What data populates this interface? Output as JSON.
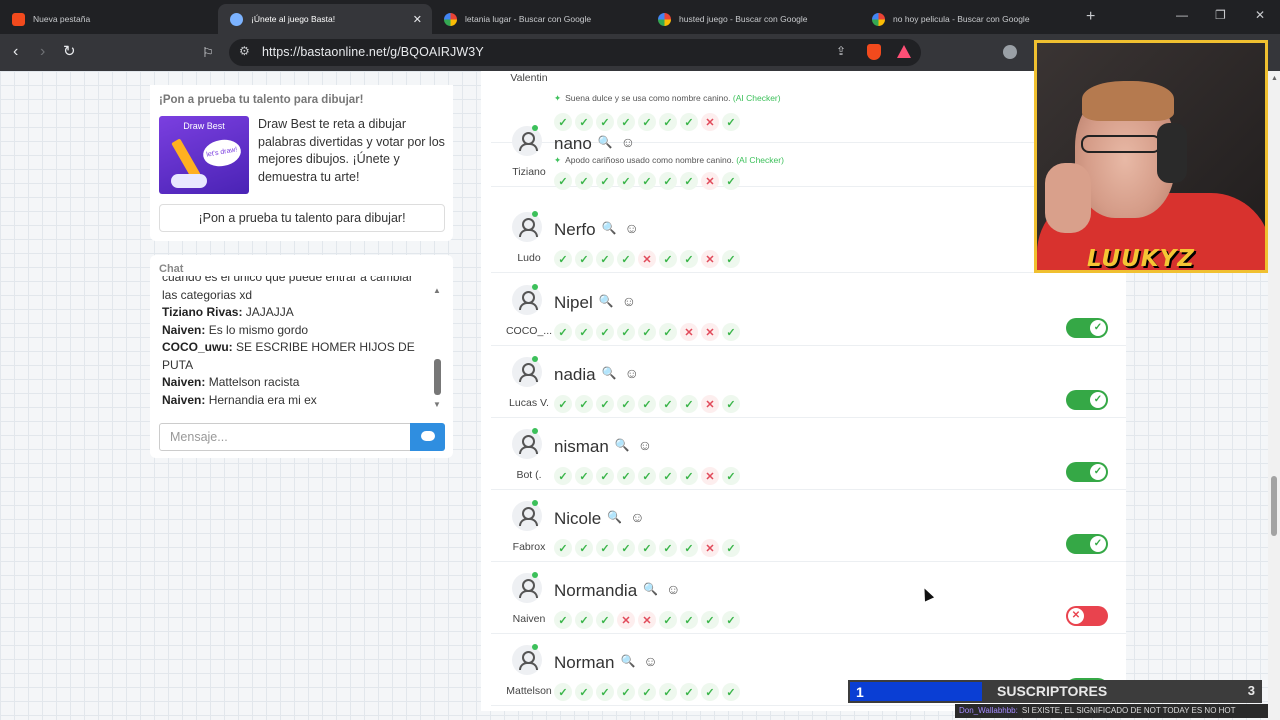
{
  "browser": {
    "tabs": [
      {
        "title": "Nueva pestaña",
        "favicon": "brave-icon"
      },
      {
        "title": "¡Únete al juego Basta!",
        "favicon": "basta-icon",
        "active": true
      },
      {
        "title": "letania lugar - Buscar con Google",
        "favicon": "google-icon"
      },
      {
        "title": "husted juego - Buscar con Google",
        "favicon": "google-icon"
      },
      {
        "title": "no hoy pelicula - Buscar con Google",
        "favicon": "google-icon"
      }
    ],
    "url": "https://bastaonline.net/g/BQOAIRJW3Y"
  },
  "ad": {
    "title": "¡Pon a prueba tu talento para dibujar!",
    "image_title": "Draw Best",
    "image_bubble": "let's draw!",
    "description": "Draw Best te reta a dibujar palabras divertidas y votar por los mejores dibujos. ¡Únete y demuestra tu arte!",
    "button": "¡Pon a prueba tu talento para dibujar!"
  },
  "chat": {
    "header": "Chat",
    "first_line": "cuando es el único que puede entrar a cambiar las categorias xd",
    "messages": [
      {
        "user": "Tiziano Rivas:",
        "text": " JAJAJJA"
      },
      {
        "user": "Naiven:",
        "text": " Es lo mismo gordo"
      },
      {
        "user": "COCO_uwu:",
        "text": " SE ESCRIBE HOMER HIJOS DE PUTA"
      },
      {
        "user": "Naiven:",
        "text": " Mattelson racista"
      },
      {
        "user": "Naiven:",
        "text": " Hernandia era mi ex"
      }
    ],
    "input_placeholder": "Mensaje..."
  },
  "players": [
    {
      "name": "Valentin",
      "answer": "",
      "checker": "Suena dulce y se usa como nombre canino.",
      "checker_tag": "(AI Checker)",
      "votes": [
        "ok",
        "ok",
        "ok",
        "ok",
        "ok",
        "ok",
        "ok",
        "no",
        "ok"
      ],
      "toggle": null
    },
    {
      "name": "Tiziano",
      "answer": "nano",
      "checker": "Apodo cariñoso usado como nombre canino.",
      "checker_tag": "(AI Checker)",
      "votes": [
        "ok",
        "ok",
        "ok",
        "ok",
        "ok",
        "ok",
        "ok",
        "no",
        "ok"
      ],
      "toggle": null
    },
    {
      "name": "Ludo",
      "answer": "Nerfo",
      "checker": "",
      "checker_tag": "",
      "votes": [
        "ok",
        "ok",
        "ok",
        "ok",
        "no",
        "ok",
        "ok",
        "no",
        "ok"
      ],
      "toggle": null
    },
    {
      "name": "COCO_...",
      "answer": "Nipel",
      "checker": "",
      "checker_tag": "",
      "votes": [
        "ok",
        "ok",
        "ok",
        "ok",
        "ok",
        "ok",
        "no",
        "no",
        "ok"
      ],
      "toggle": "on"
    },
    {
      "name": "Lucas V.",
      "answer": "nadia",
      "checker": "",
      "checker_tag": "",
      "votes": [
        "ok",
        "ok",
        "ok",
        "ok",
        "ok",
        "ok",
        "ok",
        "no",
        "ok"
      ],
      "toggle": "on"
    },
    {
      "name": "Bot (.",
      "answer": "nisman",
      "checker": "",
      "checker_tag": "",
      "votes": [
        "ok",
        "ok",
        "ok",
        "ok",
        "ok",
        "ok",
        "ok",
        "no",
        "ok"
      ],
      "toggle": "on"
    },
    {
      "name": "Fabrox",
      "answer": "Nicole",
      "checker": "",
      "checker_tag": "",
      "votes": [
        "ok",
        "ok",
        "ok",
        "ok",
        "ok",
        "ok",
        "ok",
        "no",
        "ok"
      ],
      "toggle": "on"
    },
    {
      "name": "Naiven",
      "answer": "Normandia",
      "checker": "",
      "checker_tag": "",
      "votes": [
        "ok",
        "ok",
        "ok",
        "no",
        "no",
        "ok",
        "ok",
        "ok",
        "ok"
      ],
      "toggle": "off"
    },
    {
      "name": "Mattelson",
      "answer": "Norman",
      "checker": "",
      "checker_tag": "",
      "votes": [
        "ok",
        "ok",
        "ok",
        "ok",
        "ok",
        "ok",
        "ok",
        "ok",
        "ok"
      ],
      "toggle": "on"
    }
  ],
  "stream": {
    "streamer_name": "LUUKYZ",
    "sub_count": "1",
    "sub_label": "SUSCRIPTORES",
    "sub_goal": "3",
    "ticker_user": "Don_Wallabhbb:",
    "ticker_text": "SI EXISTE, EL SIGNIFICADO DE NOT TODAY ES NO HOT"
  },
  "colors": {
    "accept": "#35a846",
    "reject": "#e9434e",
    "accent": "#2f8ee0",
    "frame": "#f0c030"
  }
}
